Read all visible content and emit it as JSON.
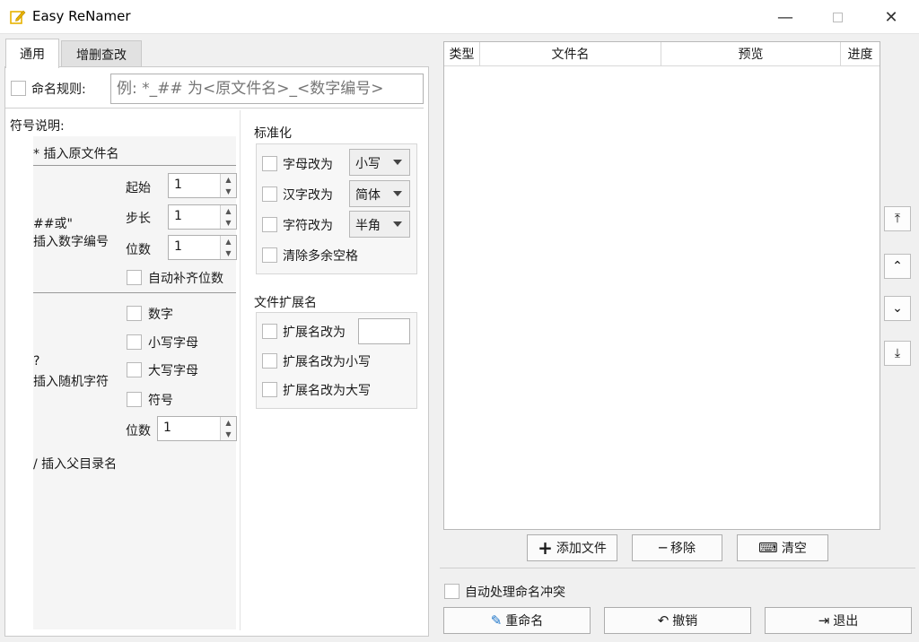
{
  "window": {
    "title": "Easy ReNamer",
    "icon": "edit-icon"
  },
  "tabs": [
    {
      "label": "通用"
    },
    {
      "label": "增删查改"
    }
  ],
  "rule": {
    "label": "命名规则:",
    "placeholder": "例: *_## 为<原文件名>_<数字编号>"
  },
  "symbols": {
    "heading": "符号说明:",
    "original_name": "* 插入原文件名",
    "number": {
      "title_line1": "##或\"",
      "title_line2": "插入数字编号",
      "start_label": "起始",
      "start_value": "1",
      "step_label": "步长",
      "step_value": "1",
      "digits_label": "位数",
      "digits_value": "1",
      "pad_label": "自动补齐位数"
    },
    "random": {
      "title_line1": "?",
      "title_line2": "插入随机字符",
      "options": [
        "数字",
        "小写字母",
        "大写字母",
        "符号"
      ],
      "digits_label": "位数",
      "digits_value": "1"
    },
    "parent_dir": "/ 插入父目录名"
  },
  "normalize": {
    "heading": "标准化",
    "letters_label": "字母改为",
    "letters_value": "小写",
    "hanzi_label": "汉字改为",
    "hanzi_value": "简体",
    "chars_label": "字符改为",
    "chars_value": "半角",
    "spaces_label": "清除多余空格"
  },
  "extension": {
    "heading": "文件扩展名",
    "change_label": "扩展名改为",
    "change_value": "",
    "lower_label": "扩展名改为小写",
    "upper_label": "扩展名改为大写"
  },
  "table": {
    "columns": [
      "类型",
      "文件名",
      "预览",
      "进度"
    ]
  },
  "file_actions": {
    "add": "添加文件",
    "remove": "移除",
    "clear": "清空"
  },
  "auto_conflict": "自动处理命名冲突",
  "main_actions": {
    "rename": "重命名",
    "undo": "撤销",
    "exit": "退出"
  },
  "colors": {
    "accent": "#1a73c8",
    "icon_yellow": "#e8b200"
  }
}
